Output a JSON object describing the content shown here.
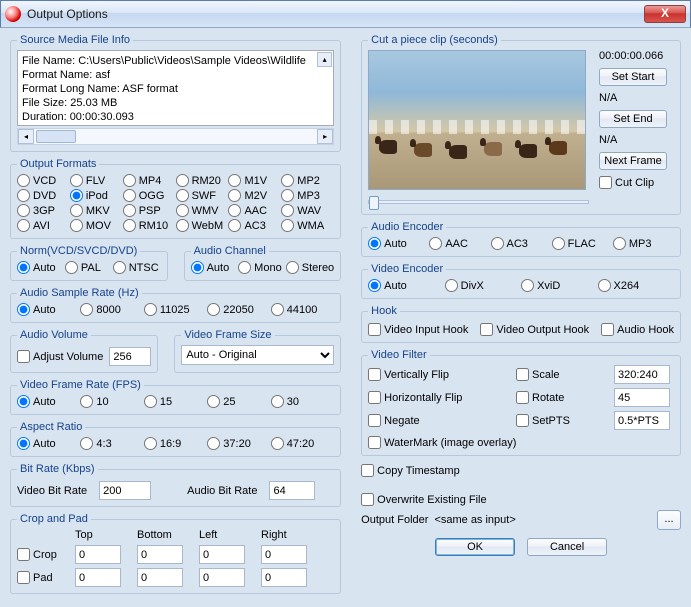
{
  "window": {
    "title": "Output Options",
    "close": "X"
  },
  "sourceInfo": {
    "legend": "Source Media File Info",
    "lines": {
      "l0": "File Name: C:\\Users\\Public\\Videos\\Sample Videos\\Wildlife",
      "l1": "Format Name: asf",
      "l2": "Format Long Name: ASF format",
      "l3": "File Size: 25.03 MB",
      "l4": "Duration: 00:00:30.093"
    }
  },
  "formats": {
    "legend": "Output Formats",
    "items": [
      "VCD",
      "FLV",
      "MP4",
      "RM20",
      "M1V",
      "MP2",
      "DVD",
      "iPod",
      "OGG",
      "SWF",
      "M2V",
      "MP3",
      "3GP",
      "MKV",
      "PSP",
      "WMV",
      "AAC",
      "WAV",
      "AVI",
      "MOV",
      "RM10",
      "WebM",
      "AC3",
      "WMA"
    ],
    "selected": "iPod"
  },
  "norm": {
    "legend": "Norm(VCD/SVCD/DVD)",
    "items": [
      "Auto",
      "PAL",
      "NTSC"
    ],
    "selected": "Auto"
  },
  "audioChannel": {
    "legend": "Audio Channel",
    "items": [
      "Auto",
      "Mono",
      "Stereo"
    ],
    "selected": "Auto"
  },
  "sampleRate": {
    "legend": "Audio Sample Rate (Hz)",
    "items": [
      "Auto",
      "8000",
      "11025",
      "22050",
      "44100"
    ],
    "selected": "Auto"
  },
  "audioVolume": {
    "legend": "Audio Volume",
    "check": "Adjust Volume",
    "value": "256"
  },
  "videoFrameSize": {
    "legend": "Video Frame Size",
    "value": "Auto - Original"
  },
  "frameRate": {
    "legend": "Video Frame Rate (FPS)",
    "items": [
      "Auto",
      "10",
      "15",
      "25",
      "30"
    ],
    "selected": "Auto"
  },
  "aspect": {
    "legend": "Aspect Ratio",
    "items": [
      "Auto",
      "4:3",
      "16:9",
      "37:20",
      "47:20"
    ],
    "selected": "Auto"
  },
  "bitRate": {
    "legend": "Bit Rate (Kbps)",
    "vLabel": "Video Bit Rate",
    "vVal": "200",
    "aLabel": "Audio Bit Rate",
    "aVal": "64"
  },
  "cropPad": {
    "legend": "Crop and Pad",
    "headers": [
      "",
      "Top",
      "Bottom",
      "Left",
      "Right"
    ],
    "cropLabel": "Crop",
    "padLabel": "Pad",
    "cropVals": [
      "0",
      "0",
      "0",
      "0"
    ],
    "padVals": [
      "0",
      "0",
      "0",
      "0"
    ]
  },
  "clip": {
    "legend": "Cut a piece clip (seconds)",
    "time": "00:00:00.066",
    "setStart": "Set Start",
    "na1": "N/A",
    "setEnd": "Set End",
    "na2": "N/A",
    "nextFrame": "Next Frame",
    "cutClip": "Cut Clip"
  },
  "audioEnc": {
    "legend": "Audio Encoder",
    "items": [
      "Auto",
      "AAC",
      "AC3",
      "FLAC",
      "MP3"
    ],
    "selected": "Auto"
  },
  "videoEnc": {
    "legend": "Video Encoder",
    "items": [
      "Auto",
      "DivX",
      "XviD",
      "X264"
    ],
    "selected": "Auto"
  },
  "hook": {
    "legend": "Hook",
    "items": [
      "Video Input Hook",
      "Video Output Hook",
      "Audio Hook"
    ]
  },
  "videoFilter": {
    "legend": "Video Filter",
    "left": [
      "Vertically Flip",
      "Horizontally Flip",
      "Negate"
    ],
    "right": [
      {
        "label": "Scale",
        "val": "320:240"
      },
      {
        "label": "Rotate",
        "val": "45"
      },
      {
        "label": "SetPTS",
        "val": "0.5*PTS"
      }
    ],
    "watermark": "WaterMark (image overlay)"
  },
  "misc": {
    "copyTs": "Copy Timestamp",
    "overwrite": "Overwrite Existing File",
    "outFolderLabel": "Output Folder",
    "outFolderVal": "<same as input>",
    "dots": "..."
  },
  "buttons": {
    "ok": "OK",
    "cancel": "Cancel"
  }
}
